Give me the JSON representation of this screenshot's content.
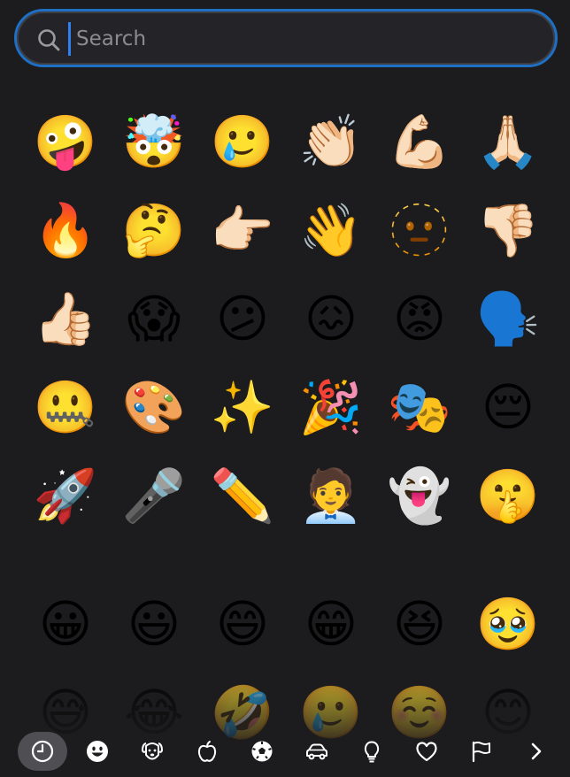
{
  "search": {
    "placeholder": "Search",
    "value": ""
  },
  "recent": [
    "🤪",
    "🤯",
    "🥲",
    "👏🏻",
    "💪🏻",
    "🙏🏻",
    "🔥",
    "🤔",
    "👉🏻",
    "👋",
    "🫥",
    "👎🏻",
    "👍🏻",
    "😱",
    "😕",
    "😖",
    "😡",
    "🗣️",
    "🤐",
    "🎨",
    "✨",
    "🎉",
    "🎭",
    "😔",
    "🚀",
    "🎤",
    "✏️",
    "🧑‍💼",
    "👻",
    "🤫"
  ],
  "people": [
    "😀",
    "😃",
    "😄",
    "😁",
    "😆",
    "🥹",
    "😅",
    "😂",
    "🤣",
    "🥲",
    "☺️",
    "😊"
  ],
  "tabs": [
    {
      "icon": "clock-icon",
      "active": true
    },
    {
      "icon": "smiley-icon",
      "active": false
    },
    {
      "icon": "dog-icon",
      "active": false
    },
    {
      "icon": "apple-icon",
      "active": false
    },
    {
      "icon": "soccer-ball-icon",
      "active": false
    },
    {
      "icon": "car-icon",
      "active": false
    },
    {
      "icon": "lightbulb-icon",
      "active": false
    },
    {
      "icon": "heart-icon",
      "active": false
    },
    {
      "icon": "flag-icon",
      "active": false
    },
    {
      "icon": "chevron-right-icon",
      "active": false
    }
  ],
  "colors": {
    "accent": "#1f6fc4",
    "background": "#1c1c1e",
    "tab_active": "#78787f"
  }
}
